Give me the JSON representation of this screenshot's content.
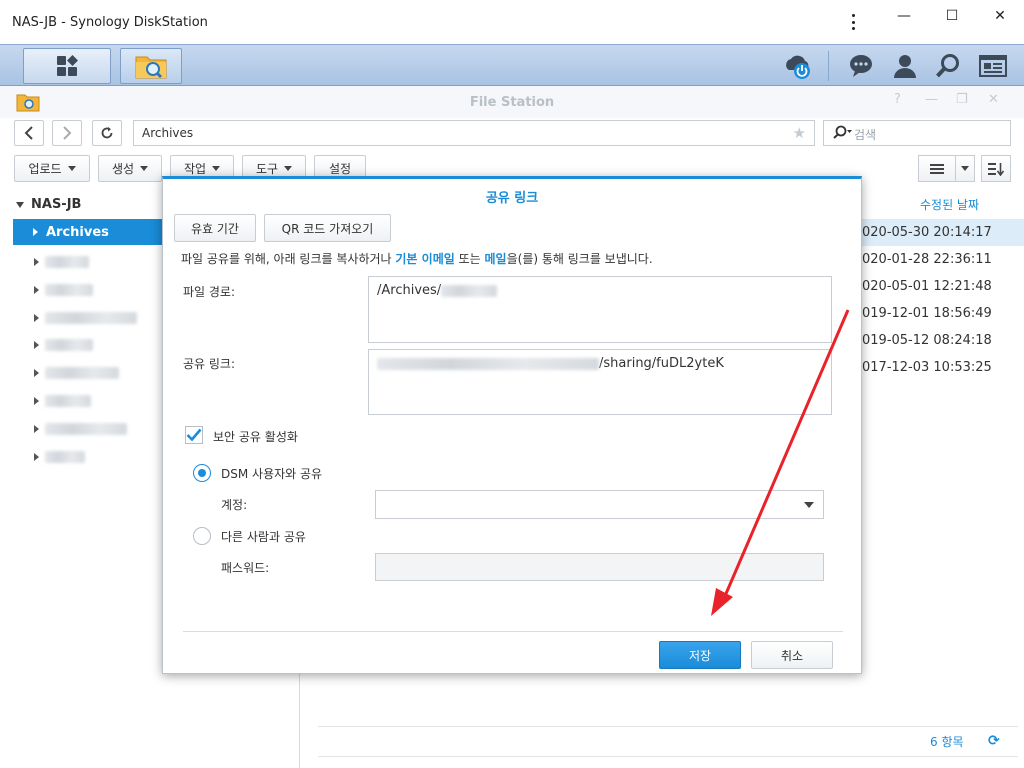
{
  "window": {
    "title": "NAS-JB - Synology DiskStation",
    "controls": {
      "menu": "⋮",
      "minimize": "—",
      "maximize": "☐",
      "close": "✕"
    }
  },
  "taskbar": {
    "apps": [
      "main-menu",
      "file-station"
    ],
    "right_icons": [
      "cloud-power-icon",
      "chat-icon",
      "user-icon",
      "search-icon",
      "widgets-icon"
    ]
  },
  "file_station": {
    "title": "File Station",
    "header_controls": {
      "help": "?",
      "minimize": "—",
      "restore": "❐",
      "close": "✕"
    },
    "path": "Archives",
    "search_placeholder": "검색",
    "toolbar": {
      "upload": "업로드",
      "create": "생성",
      "action": "작업",
      "tools": "도구",
      "settings": "설정"
    },
    "tree": {
      "root": "NAS-JB",
      "selected": "Archives"
    },
    "list": {
      "column_modified": "수정된 날짜",
      "dates": [
        "020-05-30 20:14:17",
        "020-01-28 22:36:11",
        "020-05-01 12:21:48",
        "019-12-01 18:56:49",
        "019-05-12 08:24:18",
        "017-12-03 10:53:25"
      ]
    },
    "footer": {
      "count": "6 항목",
      "refresh": "⟳"
    }
  },
  "dialog": {
    "title": "공유 링크",
    "tabs": {
      "validity": "유효 기간",
      "qr": "QR 코드 가져오기"
    },
    "description": {
      "before": "파일 공유를 위해, 아래 링크를 복사하거나 ",
      "link1": "기본 이메일",
      "middle": " 또는 ",
      "link2": "메일",
      "after": "을(를) 통해 링크를 보냅니다."
    },
    "file_path_label": "파일 경로:",
    "file_path_value": "/Archives/",
    "share_link_label": "공유 링크:",
    "share_link_value": "/sharing/fuDL2yteK",
    "secure_share_label": "보안 공유 활성화",
    "secure_share_checked": true,
    "option_dsm": "DSM 사용자와 공유",
    "account_label": "계정:",
    "option_others": "다른 사람과 공유",
    "password_label": "패스워드:",
    "save": "저장",
    "cancel": "취소"
  },
  "colors": {
    "accent": "#1a8cd8",
    "annotation_arrow": "#e8232a"
  }
}
